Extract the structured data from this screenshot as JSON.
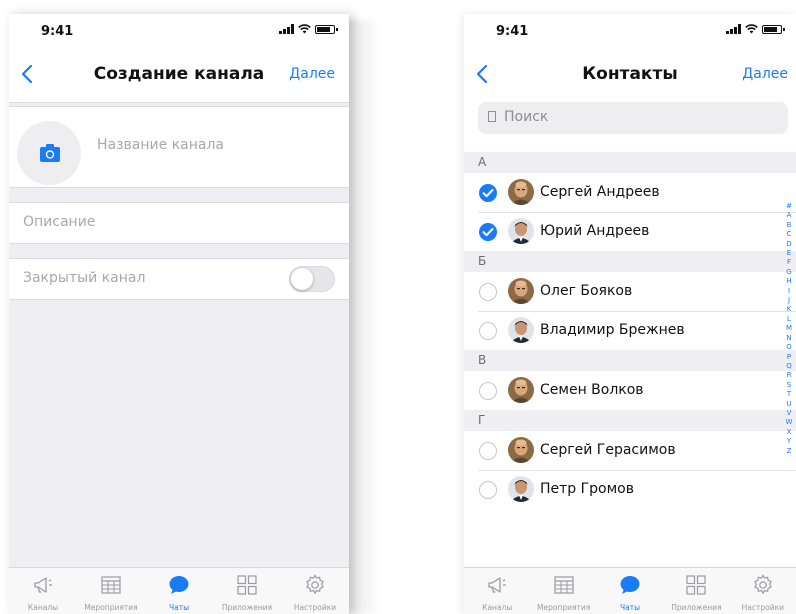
{
  "status": {
    "time": "9:41"
  },
  "screen1": {
    "title": "Создание канала",
    "next": "Далее",
    "name_placeholder": "Название канала",
    "description_placeholder": "Описание",
    "private_label": "Закрытый канал",
    "private_enabled": false
  },
  "screen2": {
    "title": "Контакты",
    "next": "Далее",
    "search_placeholder": "Поиск",
    "groups": [
      {
        "letter": "А",
        "contacts": [
          {
            "name": "Сергей Андреев",
            "checked": true,
            "avatar": "avatar-bald"
          },
          {
            "name": "Юрий Андреев",
            "checked": true,
            "avatar": "avatar-dark"
          }
        ]
      },
      {
        "letter": "Б",
        "contacts": [
          {
            "name": "Олег Бояков",
            "checked": false,
            "avatar": "avatar-bald"
          },
          {
            "name": "Владимир Брежнев",
            "checked": false,
            "avatar": "avatar-dark"
          }
        ]
      },
      {
        "letter": "В",
        "contacts": [
          {
            "name": "Семен Волков",
            "checked": false,
            "avatar": "avatar-bald"
          }
        ]
      },
      {
        "letter": "Г",
        "contacts": [
          {
            "name": "Сергей Герасимов",
            "checked": false,
            "avatar": "avatar-bald"
          },
          {
            "name": "Петр Громов",
            "checked": false,
            "avatar": "avatar-dark"
          }
        ]
      }
    ],
    "alphabet": [
      "#",
      "A",
      "B",
      "C",
      "D",
      "E",
      "F",
      "G",
      "H",
      "I",
      "J",
      "K",
      "L",
      "M",
      "N",
      "O",
      "P",
      "Q",
      "R",
      "S",
      "T",
      "U",
      "V",
      "W",
      "X",
      "Y",
      "Z"
    ]
  },
  "tabbar": [
    {
      "label": "Каналы",
      "icon": "megaphone-icon",
      "active": false
    },
    {
      "label": "Мероприятия",
      "icon": "calendar-grid-icon",
      "active": false
    },
    {
      "label": "Чаты",
      "icon": "chat-bubble-icon",
      "active": true
    },
    {
      "label": "Приложения",
      "icon": "apps-grid-icon",
      "active": false
    },
    {
      "label": "Настройки",
      "icon": "gear-icon",
      "active": false
    }
  ],
  "colors": {
    "accent": "#1a7cf5",
    "separator": "#efeff3",
    "placeholder": "#a8a8ad"
  }
}
